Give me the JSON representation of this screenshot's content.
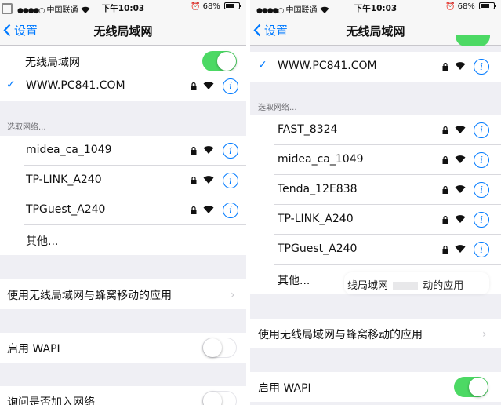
{
  "left": {
    "status": {
      "carrier": "中国联通",
      "time": "下午10:03",
      "battery": "68%"
    },
    "nav": {
      "back": "设置",
      "title": "无线局域网"
    },
    "wlan_label": "无线局域网",
    "connected": "WWW.PC841.COM",
    "section": "选取网络...",
    "networks": [
      "midea_ca_1049",
      "TP-LINK_A240",
      "TPGuest_A240"
    ],
    "other": "其他...",
    "apps": "使用无线局域网与蜂窝移动的应用",
    "wapi": "启用 WAPI",
    "ask": "询问是否加入网络"
  },
  "right": {
    "status": {
      "carrier": "中国联通",
      "time": "下午10:03",
      "battery": "68%"
    },
    "nav": {
      "back": "设置",
      "title": "无线局域网"
    },
    "connected": "WWW.PC841.COM",
    "section": "选取网络...",
    "networks": [
      "FAST_8324",
      "midea_ca_1049",
      "Tenda_12E838",
      "TP-LINK_A240",
      "TPGuest_A240"
    ],
    "other": "其他...",
    "popup": {
      "part1": "线局域网",
      "part2": "动的应用"
    },
    "apps": "使用无线局域网与蜂窝移动的应用",
    "wapi": "启用 WAPI"
  },
  "colors": {
    "accent": "#007aff",
    "toggle_on": "#4cd964",
    "group_bg": "#efeff4"
  }
}
